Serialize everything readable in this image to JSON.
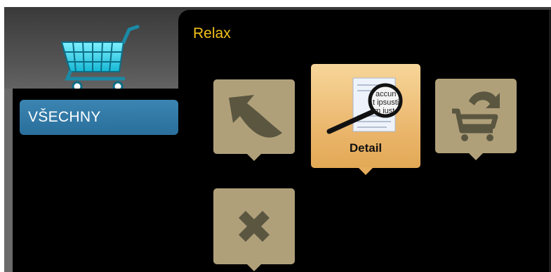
{
  "header": {
    "section_title": "Relax"
  },
  "sidebar": {
    "categories": [
      {
        "label": "VŠECHNY"
      }
    ]
  },
  "actions": {
    "back": {
      "icon": "back-arrow-icon"
    },
    "detail": {
      "label": "Detail",
      "icon": "magnifier-document-icon",
      "document_text": [
        "accun",
        "t ipsusti",
        "m iust"
      ]
    },
    "return_to_cart": {
      "icon": "cart-return-icon"
    },
    "remove": {
      "icon": "close-x-icon"
    }
  },
  "colors": {
    "title": "#f2c21a",
    "category_bg": "#2f77a5",
    "tile": "#b0a07a",
    "tile_active": "#e9b368",
    "tile_icon": "#5a5640"
  }
}
